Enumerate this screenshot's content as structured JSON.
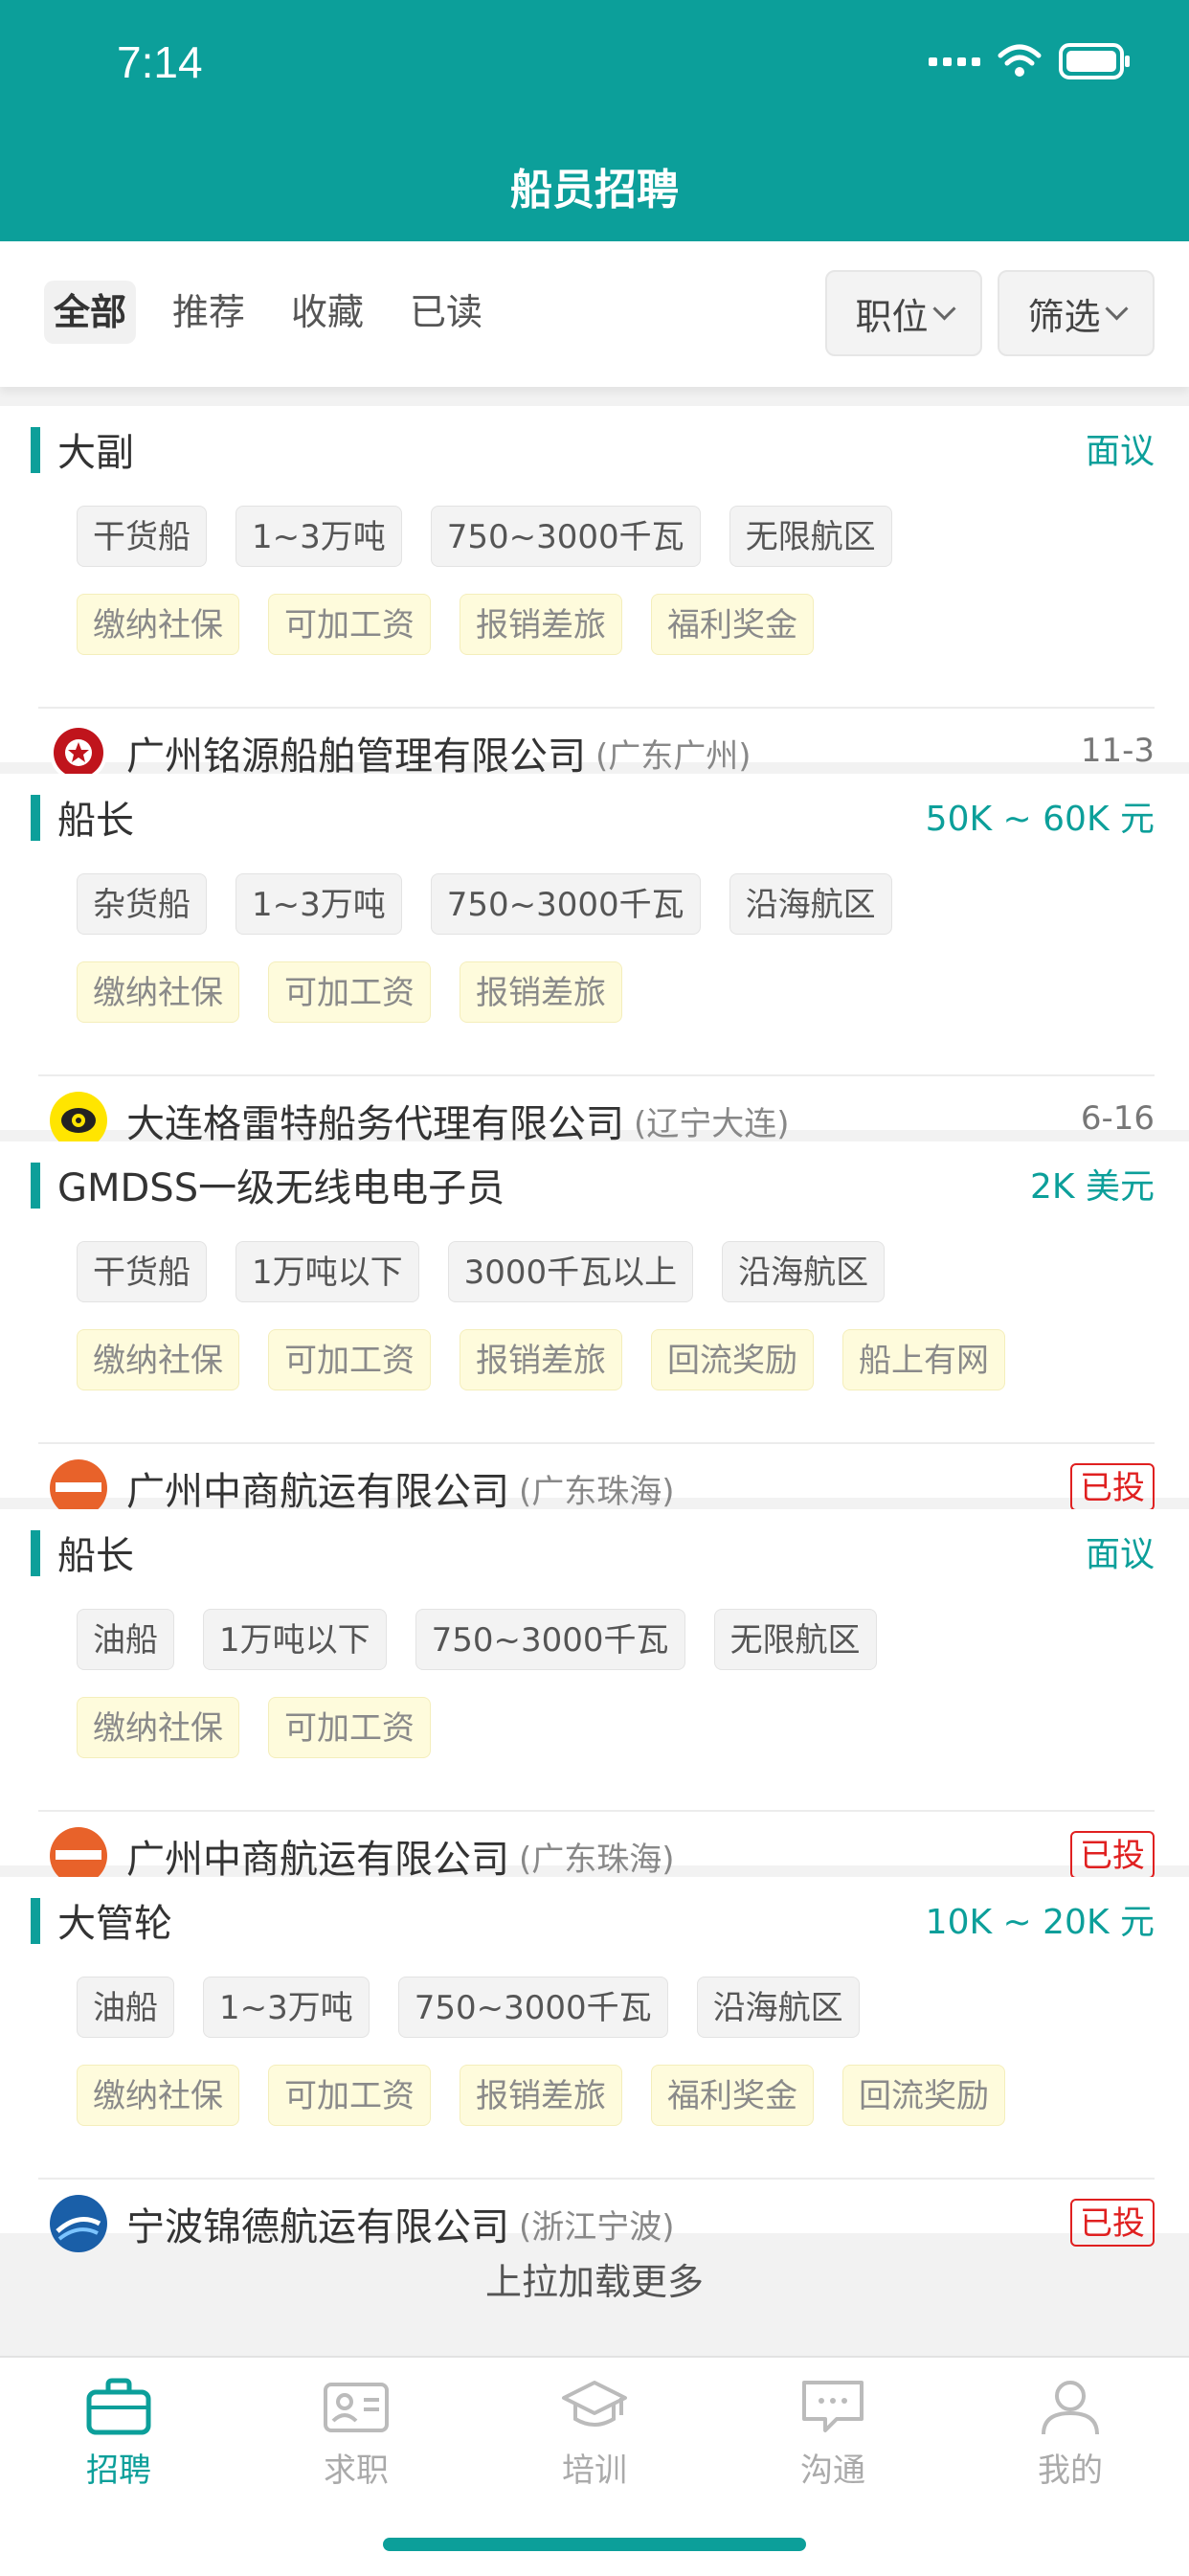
{
  "status_bar": {
    "time": "7:14"
  },
  "header": {
    "title": "船员招聘"
  },
  "filter": {
    "tabs": [
      "全部",
      "推荐",
      "收藏",
      "已读"
    ],
    "position_button": "职位",
    "filter_button": "筛选"
  },
  "jobs": [
    {
      "title": "大副",
      "salary": "面议",
      "tags": [
        "干货船",
        "1~3万吨",
        "750~3000千瓦",
        "无限航区"
      ],
      "benefits": [
        "缴纳社保",
        "可加工资",
        "报销差旅",
        "福利奖金"
      ],
      "company": "广州铭源船舶管理有限公司",
      "location": "(广东广州)",
      "date": "11-3",
      "applied": ""
    },
    {
      "title": "船长",
      "salary": "50K ~ 60K 元",
      "tags": [
        "杂货船",
        "1~3万吨",
        "750~3000千瓦",
        "沿海航区"
      ],
      "benefits": [
        "缴纳社保",
        "可加工资",
        "报销差旅"
      ],
      "company": "大连格雷特船务代理有限公司",
      "location": "(辽宁大连)",
      "date": "6-16",
      "applied": ""
    },
    {
      "title": "GMDSS一级无线电电子员",
      "salary": "2K 美元",
      "tags": [
        "干货船",
        "1万吨以下",
        "3000千瓦以上",
        "沿海航区"
      ],
      "benefits": [
        "缴纳社保",
        "可加工资",
        "报销差旅",
        "回流奖励",
        "船上有网"
      ],
      "company": "广州中商航运有限公司",
      "location": "(广东珠海)",
      "date": "",
      "applied": "已投"
    },
    {
      "title": "船长",
      "salary": "面议",
      "tags": [
        "油船",
        "1万吨以下",
        "750~3000千瓦",
        "无限航区"
      ],
      "benefits": [
        "缴纳社保",
        "可加工资"
      ],
      "company": "广州中商航运有限公司",
      "location": "(广东珠海)",
      "date": "",
      "applied": "已投"
    },
    {
      "title": "大管轮",
      "salary": "10K ~ 20K 元",
      "tags": [
        "油船",
        "1~3万吨",
        "750~3000千瓦",
        "沿海航区"
      ],
      "benefits": [
        "缴纳社保",
        "可加工资",
        "报销差旅",
        "福利奖金",
        "回流奖励"
      ],
      "company": "宁波锦德航运有限公司",
      "location": "(浙江宁波)",
      "date": "",
      "applied": "已投"
    }
  ],
  "load_more": "上拉加载更多",
  "nav": {
    "items": [
      "招聘",
      "求职",
      "培训",
      "沟通",
      "我的"
    ],
    "active": "招聘"
  },
  "colors": {
    "primary": "#0c9f9a",
    "applied": "#e02020",
    "benefit_bg": "#fefbdc"
  }
}
